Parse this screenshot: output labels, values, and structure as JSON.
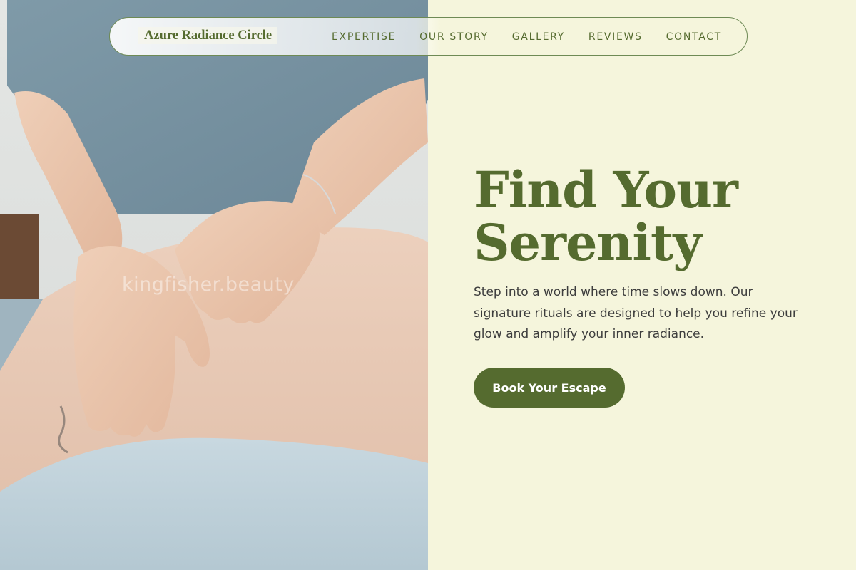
{
  "brand": {
    "name": "Azure Radiance Circle"
  },
  "nav": {
    "links": [
      {
        "label": "EXPERTISE"
      },
      {
        "label": "OUR STORY"
      },
      {
        "label": "GALLERY"
      },
      {
        "label": "REVIEWS"
      },
      {
        "label": "CONTACT"
      }
    ]
  },
  "hero": {
    "title_line1": "Find Your",
    "title_line2": "Serenity",
    "description": "Step into a world where time slows down. Our signature rituals are designed to help you refine your glow and amplify your inner radiance.",
    "cta_label": "Book Your Escape",
    "image_watermark": "kingfisher.beauty"
  },
  "colors": {
    "accent": "#556b2f",
    "background": "#f5f5dc",
    "text": "#3d3d3d"
  }
}
